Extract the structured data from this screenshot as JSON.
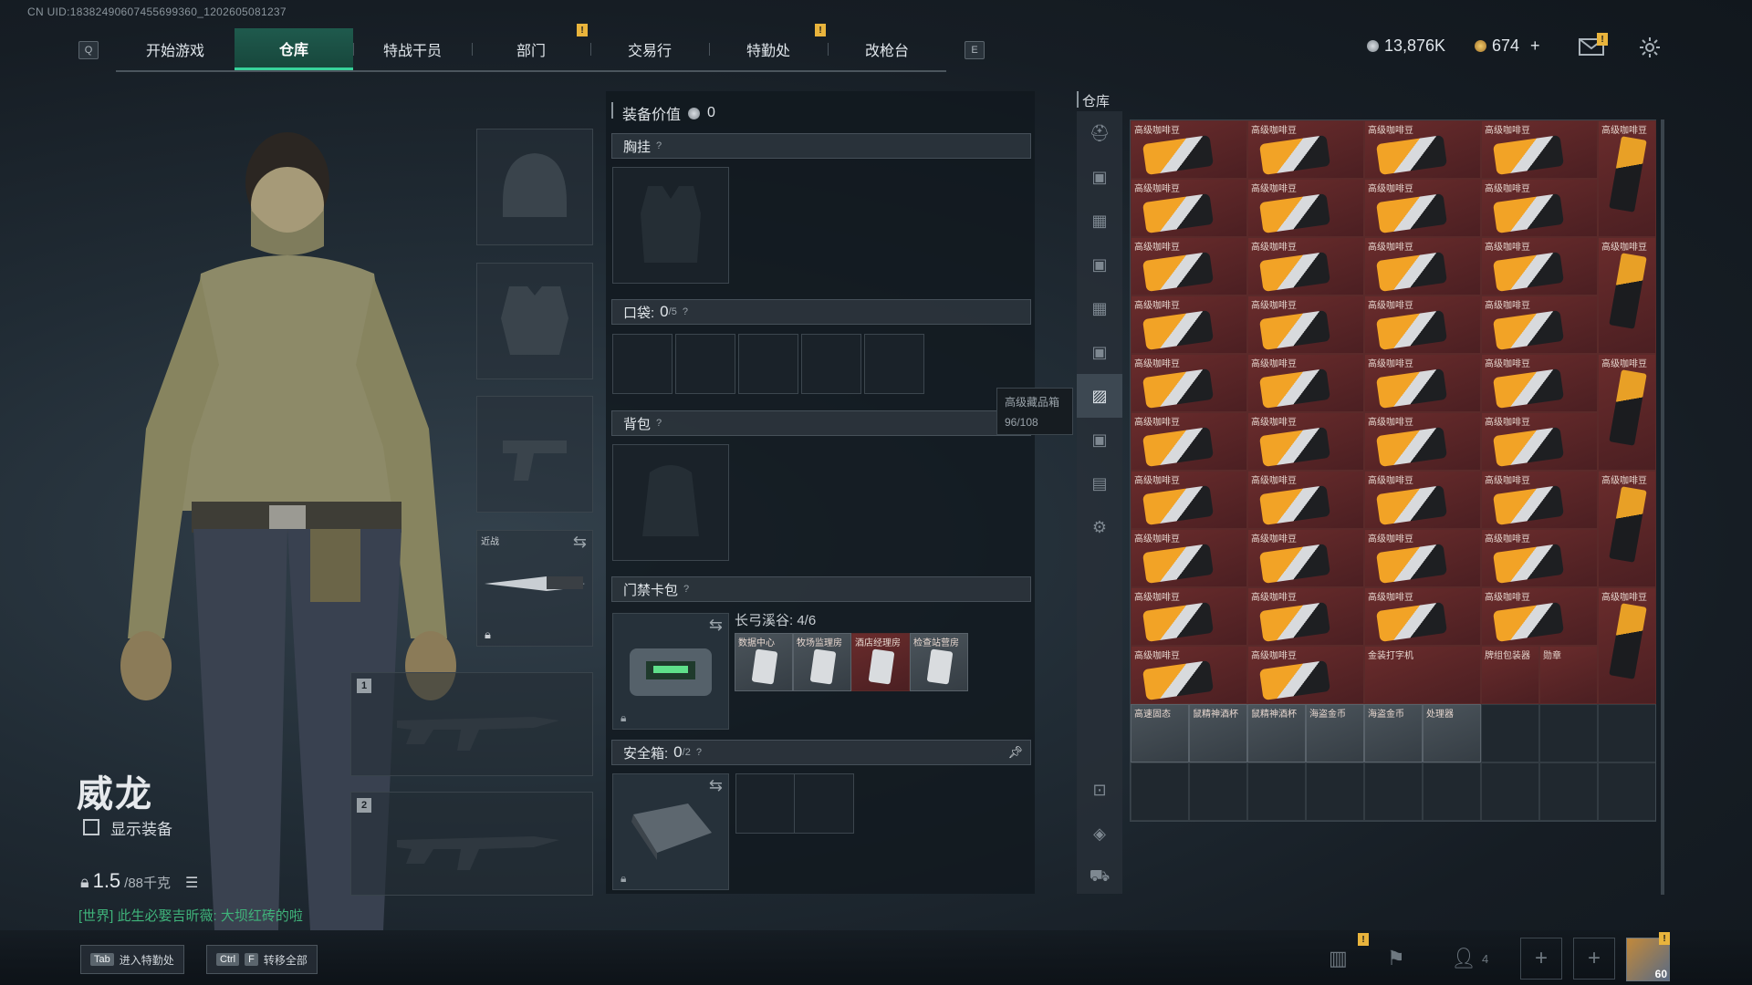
{
  "uid": "CN UID:18382490607455699360_1202605081237",
  "header": {
    "left_key": "Q",
    "right_key": "E",
    "tabs": [
      {
        "label": "开始游戏",
        "active": false
      },
      {
        "label": "仓库",
        "active": true
      },
      {
        "label": "特战干员",
        "active": false
      },
      {
        "label": "部门",
        "active": false
      },
      {
        "label": "交易行",
        "active": false
      },
      {
        "label": "特勤处",
        "active": false
      },
      {
        "label": "改枪台",
        "active": false
      }
    ],
    "badges": [
      "!",
      "!"
    ],
    "currency_silver": "13,876K",
    "currency_gold": "674",
    "currency_add": "+",
    "mail_badge": "!"
  },
  "character": {
    "name": "威龙",
    "show_gear_label": "显示装备",
    "weight_current": "1.5",
    "weight_max": "/88千克",
    "melee_label": "近战",
    "weapon_slot_1": "1",
    "weapon_slot_2": "2",
    "chat_channel": "[世界]",
    "chat_text": "此生必娶吉昕薇: 大坝红砖的啦"
  },
  "loadout": {
    "value_label": "装备价值",
    "value": "0",
    "chest_label": "胸挂",
    "pocket_label": "口袋:",
    "pocket_count": "0",
    "pocket_max": "/5",
    "backpack_label": "背包",
    "keycard_label": "门禁卡包",
    "keycard_set": "长弓溪谷: 4/6",
    "keycards": [
      "数据中心",
      "牧场监理房",
      "酒店经理房",
      "检查站营房"
    ],
    "safebox_label": "安全箱:",
    "safebox_count": "0",
    "safebox_max": "/2",
    "help": "?"
  },
  "tooltip": {
    "title": "高级藏品箱",
    "capacity": "96/108"
  },
  "warehouse": {
    "title": "仓库",
    "category_icons": [
      "helmet-icon",
      "iv-icon",
      "gear-icon-1",
      "iv-icon-2",
      "box-icon",
      "camera-icon",
      "camera-icon-selected",
      "iv-icon-3",
      "gt-icon",
      "settings-icon",
      "safe-icon",
      "layers-icon",
      "cart-icon"
    ],
    "coffee_name": "高级咖啡豆",
    "row10": [
      "高级咖啡豆",
      "高级咖啡豆",
      "金装打字机",
      "牌组包装器",
      "勋章",
      "高级咖啡豆"
    ],
    "row11": [
      "高速固态",
      "鼠精神酒杯",
      "鼠精神酒杯",
      "海盗金币",
      "海盗金币",
      "处理器"
    ]
  },
  "bottom": {
    "tab_key": "Tab",
    "tab_label": "进入特勤处",
    "ctrl_key": "Ctrl",
    "f_key": "F",
    "transfer_label": "转移全部",
    "friends_count": "4",
    "avatar_level": "60"
  }
}
